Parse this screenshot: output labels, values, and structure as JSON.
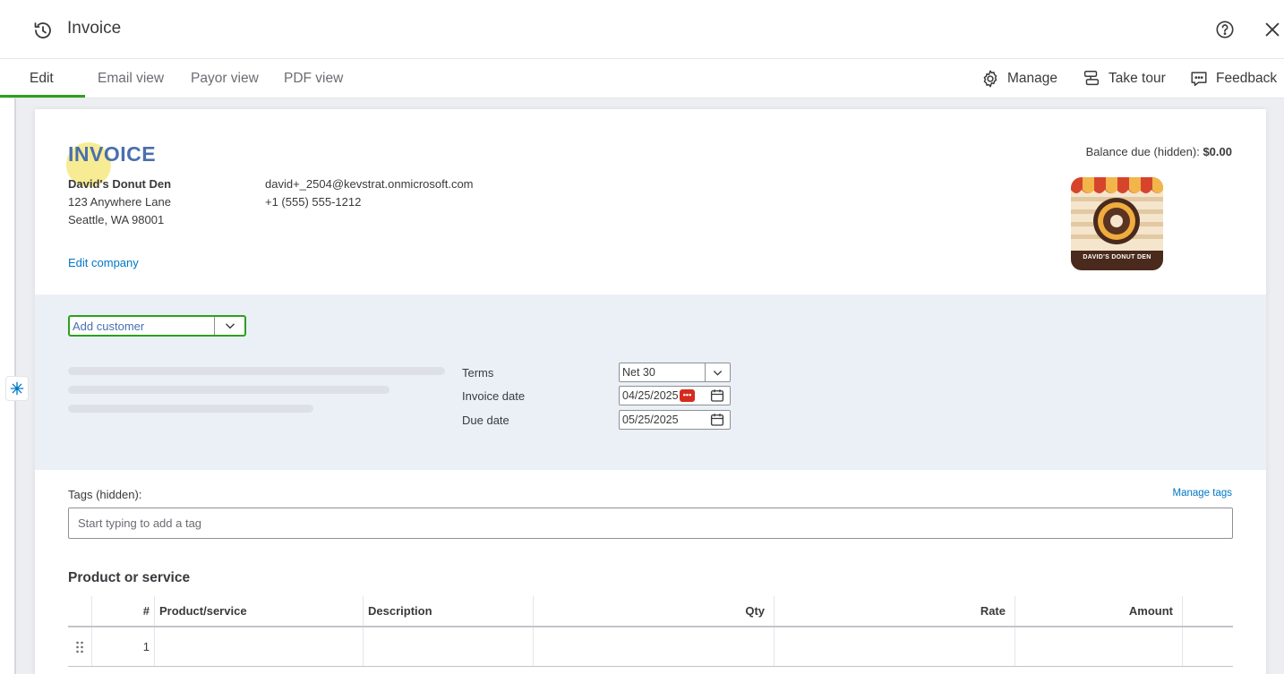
{
  "header": {
    "title": "Invoice"
  },
  "tabs": [
    {
      "label": "Edit",
      "active": true
    },
    {
      "label": "Email view"
    },
    {
      "label": "Payor view"
    },
    {
      "label": "PDF view"
    }
  ],
  "toolbar": {
    "manage": "Manage",
    "take_tour": "Take tour",
    "feedback": "Feedback"
  },
  "invoice": {
    "heading": "INVOICE",
    "balance_label": "Balance due (hidden):",
    "balance_value": "$0.00",
    "company": {
      "name": "David's Donut Den",
      "address1": "123 Anywhere Lane",
      "address2": "Seattle, WA 98001",
      "email": "david+_2504@kevstrat.onmicrosoft.com",
      "phone": "+1 (555) 555-1212",
      "edit_link": "Edit company",
      "logo_text": "DAVID'S DONUT DEN"
    },
    "customer": {
      "placeholder": "Add customer"
    },
    "fields": {
      "terms_label": "Terms",
      "terms_value": "Net 30",
      "invoice_date_label": "Invoice date",
      "invoice_date_value": "04/25/2025",
      "due_date_label": "Due date",
      "due_date_value": "05/25/2025",
      "badge": "•••"
    },
    "tags": {
      "label": "Tags (hidden):",
      "manage": "Manage tags",
      "placeholder": "Start typing to add a tag"
    },
    "products": {
      "title": "Product or service",
      "columns": [
        "#",
        "Product/service",
        "Description",
        "Qty",
        "Rate",
        "Amount"
      ],
      "rows": [
        {
          "num": "1"
        }
      ]
    }
  },
  "colors": {
    "accent_green": "#2ca01c",
    "link_blue": "#0077c5",
    "heading_blue": "#4a6fae",
    "section_bg": "#ebf0f7"
  }
}
